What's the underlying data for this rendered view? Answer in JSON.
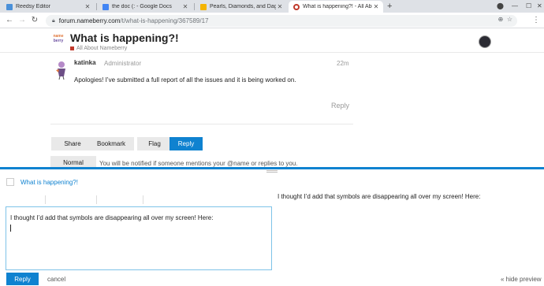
{
  "browser": {
    "tabs": [
      {
        "title": "Reedsy Editor",
        "favicon_color": "#4a90d9"
      },
      {
        "title": "the doc (: - Google Docs",
        "favicon_color": "#4285f4"
      },
      {
        "title": "Pearls, Diamonds, and Daggers",
        "favicon_color": "#f4b400"
      },
      {
        "title": "What is happening?! - All About N",
        "favicon_color": "#c0392b"
      }
    ],
    "new_tab_label": "+",
    "url_host": "forum.nameberry.com",
    "url_path": "/t/what-is-happening/367589/17"
  },
  "forum": {
    "logo_top": "name",
    "logo_bottom": "berry",
    "title": "What is happening?!",
    "category": "All About Nameberry"
  },
  "post": {
    "username": "katinka",
    "role": "Administrator",
    "time": "22m",
    "body": "Apologies! I’ve submitted a full report of all the issues and it is being worked on.",
    "reply_label": "Reply"
  },
  "footer": {
    "share": "Share",
    "bookmark": "Bookmark",
    "flag": "Flag",
    "reply": "Reply",
    "notification_level": "Normal",
    "notification_text": "You will be notified if someone mentions your @name or replies to you."
  },
  "composer": {
    "reply_to": "What is happening?!",
    "draft": "I thought I’d add that symbols are disappearing all over my screen! Here:",
    "preview": "I thought I’d add that symbols are disappearing all over my screen! Here:",
    "submit": "Reply",
    "cancel": "cancel",
    "hide_preview": "« hide preview",
    "accent_color": "#0f82d0"
  }
}
